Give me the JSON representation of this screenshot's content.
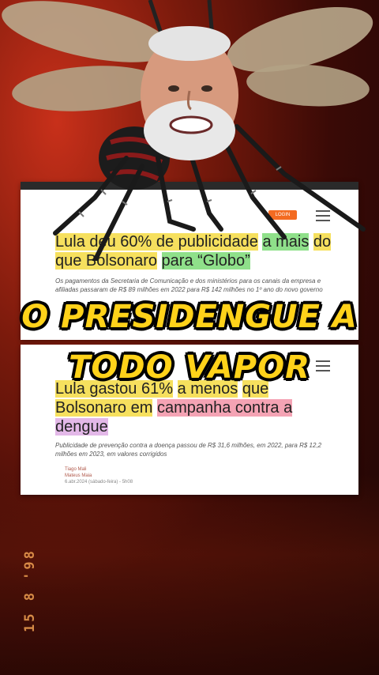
{
  "overlay": {
    "line1": "O PRESIDENGUE A",
    "line2": "TODO VAPOR"
  },
  "article_top": {
    "logo": "LOGIN",
    "headline_part1": "Lula deu 60% de publicidade",
    "headline_part2": "a mais",
    "headline_part3": "do que Bolsonaro",
    "headline_part4": "para “Globo”",
    "subtitle": "Os pagamentos da Secretaria de Comunicação e dos ministérios para os canais da empresa e afiliadas passaram de R$ 89 milhões em 2022 para R$ 142 milhões no 1º ano do novo governo"
  },
  "article_bottom": {
    "headline_part1": "Lula gastou 61%",
    "headline_part2": "a menos",
    "headline_part3": "que",
    "headline_part4": "Bolsonaro em",
    "headline_part5": "campanha contra a",
    "headline_part6": "dengue",
    "subtitle": "Publicidade de prevenção contra a doença passou de R$ 31,6 milhões, em 2022, para R$ 12,2 milhões em 2023, em valores corrigidos",
    "author1": "Tiago Mali",
    "author2": "Mateus Maia",
    "date": "6.abr.2024 (sábado-feira) - 5h08"
  },
  "timestamp": "15 8 '98",
  "colors": {
    "overlay_text": "#ffd21a",
    "highlight_yellow": "#f6e05e",
    "highlight_green": "#8fe08a",
    "highlight_pink": "#f4a3b4"
  }
}
